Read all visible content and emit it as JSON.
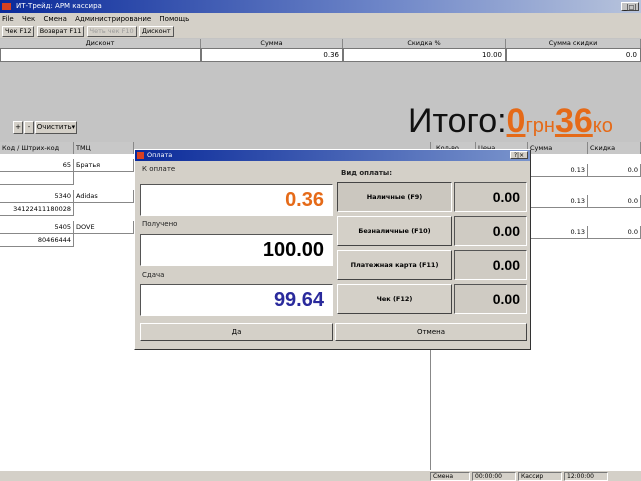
{
  "window": {
    "title": "ИТ-Трейд: АРМ кассира",
    "controls": "_|□|×"
  },
  "menu": [
    "File",
    "Чек",
    "Смена",
    "Администрирование",
    "Помощь"
  ],
  "toolbar": [
    "Чек F12",
    "Возврат F11",
    "Четь чек F10",
    "Дисконт"
  ],
  "discount_header": {
    "discount": "Дисконт",
    "sum": "Сумма",
    "percent": "Скидка %",
    "discount_sum": "Сумма скидки"
  },
  "discount_values": {
    "discount": "",
    "sum": "0.36",
    "percent": "10.00",
    "discount_sum": "0.0"
  },
  "controls": {
    "plus": "+",
    "minus": "-",
    "clear": "Очистить"
  },
  "total": {
    "label": "Итого:",
    "uah": "0",
    "uah_unit": "грн",
    "kop": "36",
    "kop_unit": "ко"
  },
  "table": {
    "headers": {
      "code": "Код / Штрих-код",
      "item": "ТМЦ",
      "qty": "Кол-во",
      "price": "Цена",
      "sum": "Сумма",
      "discount": "Скидка"
    },
    "rows": [
      {
        "code": "65",
        "barcode": "",
        "item": "Братья",
        "sum": "0.13",
        "discount": "0.0"
      },
      {
        "code": "5340",
        "barcode": "34122411180028",
        "item": "Adidas",
        "sum": "0.13",
        "discount": "0.0"
      },
      {
        "code": "5405",
        "barcode": "80466444",
        "item": "DOVE",
        "sum": "0.13",
        "discount": "0.0"
      }
    ]
  },
  "dialog": {
    "title": "Оплата",
    "to_pay_label": "К оплате",
    "to_pay": "0.36",
    "received_label": "Получено",
    "received": "100.00",
    "change_label": "Сдача",
    "change": "99.64",
    "payment_type_label": "Вид оплаты:",
    "payment_types": [
      {
        "label": "Наличные (F9)",
        "value": "0.00"
      },
      {
        "label": "Безналичные (F10)",
        "value": "0.00"
      },
      {
        "label": "Платежная карта (F11)",
        "value": "0.00"
      },
      {
        "label": "Чек (F12)",
        "value": "0.00"
      }
    ],
    "ok": "Да",
    "cancel": "Отмена"
  },
  "status": [
    "Смена",
    "00:00:00",
    "Кассир",
    "12:00:00"
  ],
  "colors": {
    "accent_orange": "#e56a18",
    "change_blue": "#2a2a9c",
    "title_blue": "#0a2a9a"
  }
}
